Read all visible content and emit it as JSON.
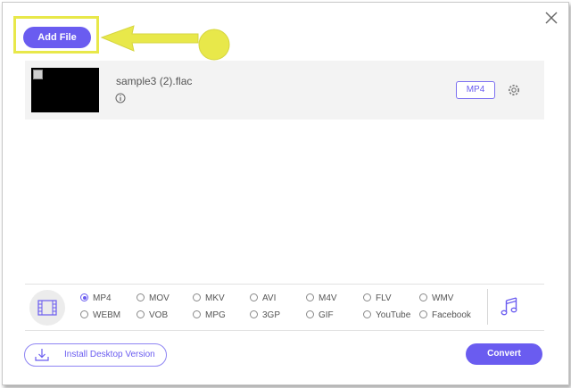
{
  "toolbar": {
    "add_file_label": "Add File"
  },
  "file": {
    "name": "sample3 (2).flac",
    "output_format": "MP4"
  },
  "formats": {
    "selected": "MP4",
    "video_options": [
      "MP4",
      "MOV",
      "MKV",
      "AVI",
      "M4V",
      "FLV",
      "WMV",
      "WEBM",
      "VOB",
      "MPG",
      "3GP",
      "GIF",
      "YouTube",
      "Facebook"
    ]
  },
  "footer": {
    "install_label": "Install Desktop Version",
    "convert_label": "Convert"
  },
  "icons": {
    "close": "close-icon",
    "info": "info-icon",
    "settings": "gear-icon",
    "video_tab": "film-icon",
    "audio_tab": "music-note-icon",
    "download": "download-icon",
    "annotation": "yellow-arrow"
  },
  "colors": {
    "accent": "#6a5cf0",
    "highlight": "#e8e84a",
    "row_bg": "#f3f3f3"
  }
}
